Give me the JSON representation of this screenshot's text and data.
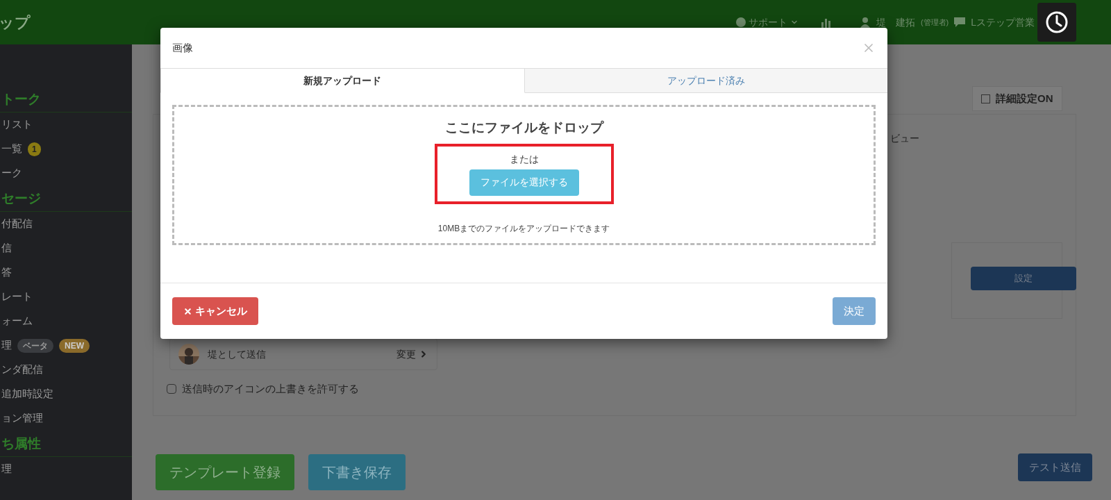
{
  "header": {
    "logo": "ップ",
    "support": "サポート",
    "user": "堤　建拓",
    "role": "(管理者)",
    "account": "Lステップ営業"
  },
  "sidebar": {
    "sections": [
      {
        "heading": "トーク",
        "items": [
          {
            "label": "リスト"
          },
          {
            "label": "一覧",
            "badges": [
              {
                "text": "1",
                "kind": "count"
              }
            ]
          },
          {
            "label": "ーク"
          }
        ]
      },
      {
        "heading": "セージ",
        "items": [
          {
            "label": "付配信"
          },
          {
            "label": "信"
          },
          {
            "label": "答"
          },
          {
            "label": "レート"
          },
          {
            "label": "ォーム"
          },
          {
            "label": "理",
            "badges": [
              {
                "text": "ベータ",
                "kind": "beta"
              },
              {
                "text": "NEW",
                "kind": "new"
              }
            ]
          },
          {
            "label": "ンダ配信"
          },
          {
            "label": "追加時設定"
          },
          {
            "label": "ョン管理"
          }
        ]
      },
      {
        "heading": "ち属性",
        "items": [
          {
            "label": "理"
          }
        ]
      }
    ]
  },
  "background": {
    "advanced_toggle": {
      "label": "詳細設定ON",
      "checked": false
    },
    "preview_label": "ビュー",
    "settings_button": "設定",
    "sender": {
      "label": "堤として送信",
      "change": "変更"
    },
    "override_icon": {
      "label": "送信時のアイコンの上書きを許可する",
      "checked": false
    },
    "buttons": [
      {
        "label": "テンプレート登録",
        "kind": "success"
      },
      {
        "label": "下書き保存",
        "kind": "info"
      }
    ],
    "test_button": "テスト送信"
  },
  "modal": {
    "title": "画像",
    "tabs": [
      {
        "label": "新規アップロード",
        "selected": true
      },
      {
        "label": "アップロード済み",
        "selected": false
      }
    ],
    "dropzone": {
      "heading": "ここにファイルをドロップ",
      "or": "または",
      "button": "ファイルを選択する",
      "note": "10MBまでのファイルをアップロードできます",
      "highlighted": true
    },
    "cancel": "キャンセル",
    "confirm": "決定"
  }
}
